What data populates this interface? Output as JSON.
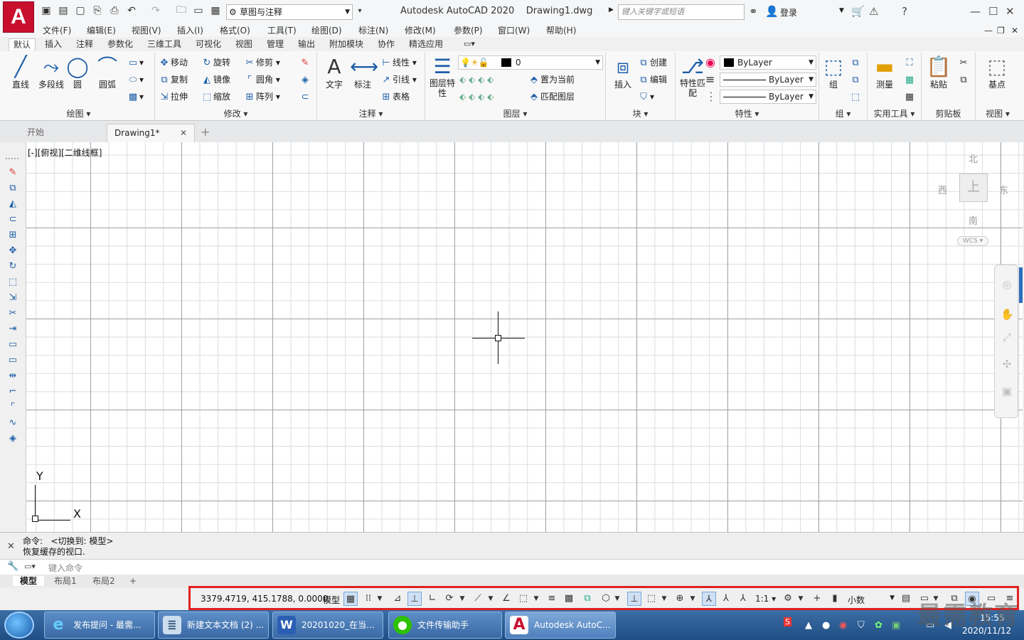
{
  "titlebar": {
    "workspace": "草图与注释",
    "app_title": "Autodesk AutoCAD 2020",
    "doc_title": "Drawing1.dwg",
    "search_placeholder": "键入关键字或短语",
    "login": "登录",
    "app_letter": "A"
  },
  "menubar": [
    "文件(F)",
    "编辑(E)",
    "视图(V)",
    "插入(I)",
    "格式(O)",
    "工具(T)",
    "绘图(D)",
    "标注(N)",
    "修改(M)",
    "参数(P)",
    "窗口(W)",
    "帮助(H)"
  ],
  "ribbon_tabs": [
    "默认",
    "插入",
    "注释",
    "参数化",
    "三维工具",
    "可视化",
    "视图",
    "管理",
    "输出",
    "附加模块",
    "协作",
    "精选应用"
  ],
  "panels": {
    "draw": {
      "title": "绘图",
      "items": [
        "直线",
        "多段线",
        "圆",
        "圆弧"
      ]
    },
    "modify": {
      "title": "修改",
      "items": [
        "移动",
        "旋转",
        "修剪",
        "复制",
        "镜像",
        "圆角",
        "拉伸",
        "缩放",
        "阵列"
      ]
    },
    "annotate": {
      "title": "注释",
      "items": [
        "文字",
        "标注",
        "线性",
        "引线",
        "表格"
      ]
    },
    "layers": {
      "title": "图层",
      "layer_props": "图层特性",
      "current_layer": "0",
      "set_current": "置为当前",
      "match_layer": "匹配图层"
    },
    "block": {
      "title": "块",
      "items": [
        "插入",
        "创建",
        "编辑"
      ]
    },
    "properties": {
      "title": "特性",
      "match": "特性匹配",
      "color": "ByLayer",
      "linetype": "ByLayer",
      "lineweight": "ByLayer"
    },
    "groups": {
      "title": "组",
      "item": "组"
    },
    "utilities": {
      "title": "实用工具",
      "item": "测量"
    },
    "clipboard": {
      "title": "剪贴板",
      "item": "粘贴"
    },
    "view": {
      "title": "视图",
      "item": "基点"
    }
  },
  "doc_tabs": {
    "start": "开始",
    "drawing": "Drawing1*"
  },
  "viewport": {
    "label": "[-][俯视][二维线框]",
    "north": "北",
    "south": "南",
    "east": "东",
    "west": "西",
    "top": "上",
    "wcs": "WCS",
    "x_axis": "X",
    "y_axis": "Y"
  },
  "command": {
    "line1_prefix": "命令:",
    "line1_text": "<切换到: 模型>",
    "line2": "恢复缓存的视口.",
    "placeholder": "键入命令"
  },
  "layout_tabs": [
    "模型",
    "布局1",
    "布局2"
  ],
  "status": {
    "coords": "3379.4719, 415.1788, 0.0000",
    "model": "模型",
    "scale": "1:1",
    "units": "小数"
  },
  "taskbar": {
    "items": [
      "发布提问 - 最需...",
      "新建文本文档 (2) ...",
      "20201020_在当...",
      "文件传输助手",
      "Autodesk AutoC..."
    ],
    "time": "15:55",
    "date": "2020/11/12"
  },
  "watermark": "最需教育"
}
